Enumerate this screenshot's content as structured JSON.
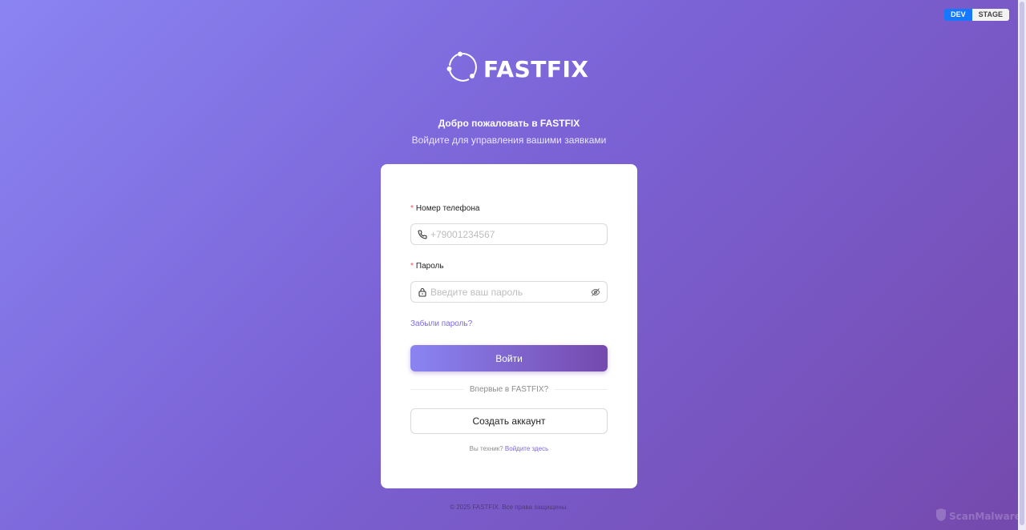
{
  "env_switch": {
    "dev_label": "DEV",
    "stage_label": "STAGE",
    "active": "DEV"
  },
  "brand": {
    "name": "FASTFIX"
  },
  "welcome": {
    "title": "Добро пожаловать в FASTFIX",
    "subtitle": "Войдите для управления вашими заявками"
  },
  "form": {
    "phone": {
      "label": "Номер телефона",
      "required_mark": "*",
      "placeholder": "+79001234567",
      "value": "",
      "icon": "phone-icon"
    },
    "password": {
      "label": "Пароль",
      "required_mark": "*",
      "placeholder": "Введите ваш пароль",
      "value": "",
      "icon": "lock-icon",
      "toggle_icon": "eye-off-icon"
    },
    "forgot_link": "Забыли пароль?",
    "submit_label": "Войти",
    "divider_text": "Впервые в FASTFIX?",
    "create_account_label": "Создать аккаунт",
    "technician_prompt": "Вы техник?",
    "technician_link": "Войдите здесь"
  },
  "footer": {
    "copyright": "© 2025 FASTFIX. Все права защищены."
  },
  "watermark": {
    "text": "ScanMalware"
  },
  "colors": {
    "accent": "#7b6ae0",
    "gradient_start": "#8a84f2",
    "gradient_end": "#7549ad",
    "env_active": "#1677ff",
    "required": "#ff4d4f"
  }
}
